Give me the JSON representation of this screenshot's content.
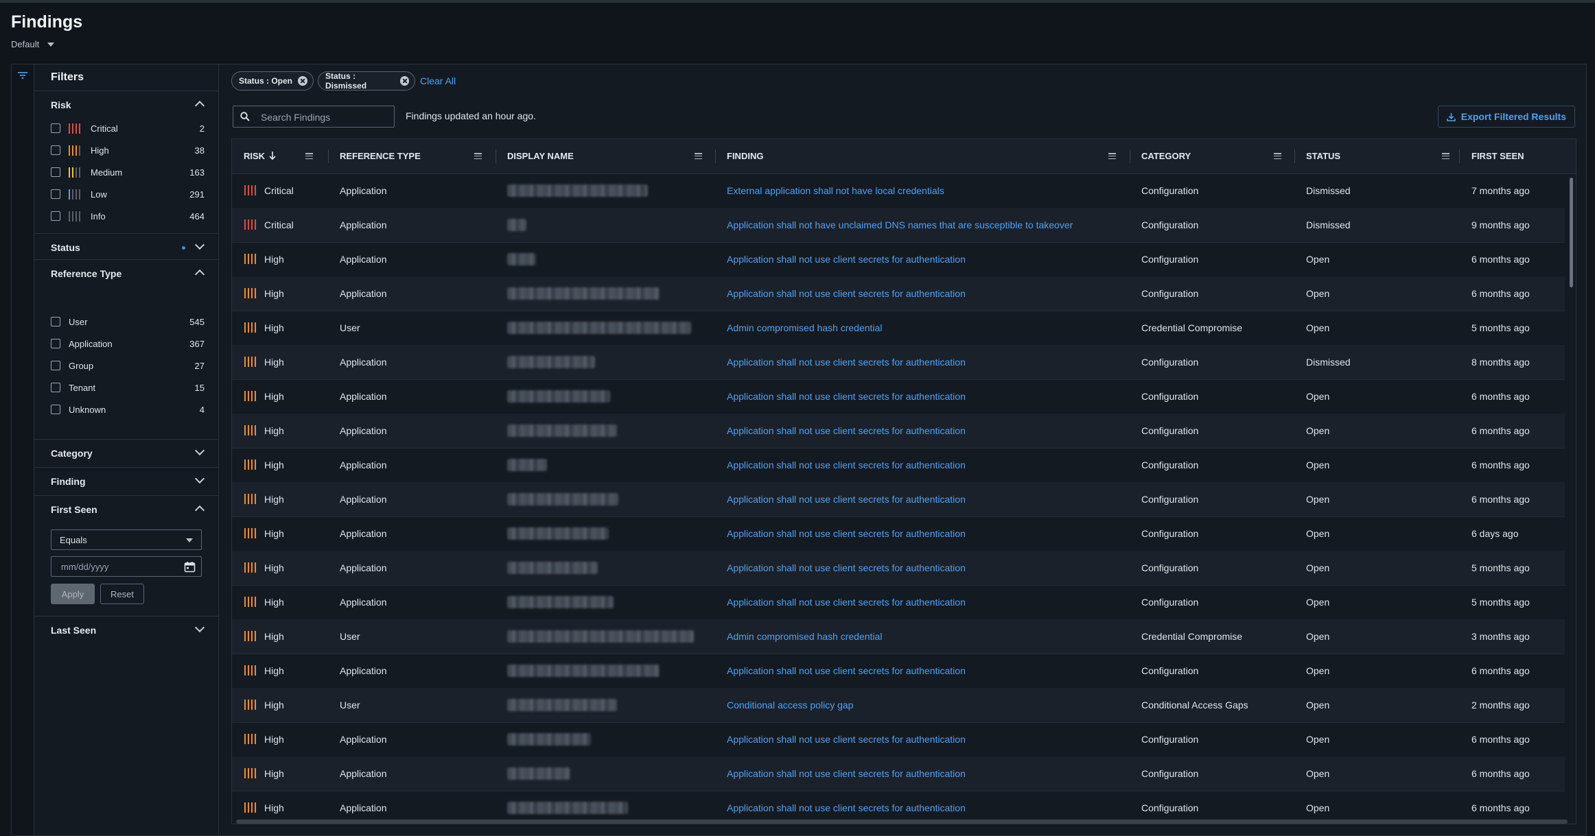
{
  "page": {
    "title": "Findings",
    "view": "Default"
  },
  "colors": {
    "critical": "#e04b3d",
    "high": "#f08a2c",
    "medium": "#e9c23c",
    "low": "#5aa0d8",
    "info": "#8a939e",
    "inactive": "#59606a",
    "link": "#4ea1f3"
  },
  "filters": {
    "title": "Filters",
    "risk": {
      "label": "Risk",
      "items": [
        {
          "label": "Critical",
          "count": "2",
          "level": 4,
          "color": "#e04b3d"
        },
        {
          "label": "High",
          "count": "38",
          "level": 3,
          "color": "#f08a2c"
        },
        {
          "label": "Medium",
          "count": "163",
          "level": 2,
          "color": "#e9c23c"
        },
        {
          "label": "Low",
          "count": "291",
          "level": 1,
          "color": "#5aa0d8"
        },
        {
          "label": "Info",
          "count": "464",
          "level": 0,
          "color": "#8a939e"
        }
      ]
    },
    "status": {
      "label": "Status"
    },
    "reference_type": {
      "label": "Reference Type",
      "items": [
        {
          "label": "User",
          "count": "545"
        },
        {
          "label": "Application",
          "count": "367"
        },
        {
          "label": "Group",
          "count": "27"
        },
        {
          "label": "Tenant",
          "count": "15"
        },
        {
          "label": "Unknown",
          "count": "4"
        }
      ]
    },
    "category": {
      "label": "Category"
    },
    "finding": {
      "label": "Finding"
    },
    "first_seen": {
      "label": "First Seen",
      "operator": "Equals",
      "date_placeholder": "mm/dd/yyyy",
      "apply_label": "Apply",
      "reset_label": "Reset"
    },
    "last_seen": {
      "label": "Last Seen"
    }
  },
  "chips": [
    {
      "label": "Status : Open"
    },
    {
      "label": "Status : Dismissed"
    }
  ],
  "clear_all": "Clear All",
  "search": {
    "placeholder": "Search Findings"
  },
  "updated_text": "Findings updated an hour ago.",
  "export_label": "Export Filtered Results",
  "table": {
    "columns": [
      "RISK",
      "REFERENCE TYPE",
      "DISPLAY NAME",
      "FINDING",
      "CATEGORY",
      "STATUS",
      "FIRST SEEN"
    ],
    "rows": [
      {
        "risk": "Critical",
        "ref": "Application",
        "finding": "External application shall not have local credentials",
        "category": "Configuration",
        "status": "Dismissed",
        "first_seen": "7 months ago"
      },
      {
        "risk": "Critical",
        "ref": "Application",
        "finding": "Application shall not have unclaimed DNS names that are susceptible to takeover",
        "category": "Configuration",
        "status": "Dismissed",
        "first_seen": "9 months ago"
      },
      {
        "risk": "High",
        "ref": "Application",
        "finding": "Application shall not use client secrets for authentication",
        "category": "Configuration",
        "status": "Open",
        "first_seen": "6 months ago"
      },
      {
        "risk": "High",
        "ref": "Application",
        "finding": "Application shall not use client secrets for authentication",
        "category": "Configuration",
        "status": "Open",
        "first_seen": "6 months ago"
      },
      {
        "risk": "High",
        "ref": "User",
        "finding": "Admin compromised hash credential",
        "category": "Credential Compromise",
        "status": "Open",
        "first_seen": "5 months ago"
      },
      {
        "risk": "High",
        "ref": "Application",
        "finding": "Application shall not use client secrets for authentication",
        "category": "Configuration",
        "status": "Dismissed",
        "first_seen": "8 months ago"
      },
      {
        "risk": "High",
        "ref": "Application",
        "finding": "Application shall not use client secrets for authentication",
        "category": "Configuration",
        "status": "Open",
        "first_seen": "6 months ago"
      },
      {
        "risk": "High",
        "ref": "Application",
        "finding": "Application shall not use client secrets for authentication",
        "category": "Configuration",
        "status": "Open",
        "first_seen": "6 months ago"
      },
      {
        "risk": "High",
        "ref": "Application",
        "finding": "Application shall not use client secrets for authentication",
        "category": "Configuration",
        "status": "Open",
        "first_seen": "6 months ago"
      },
      {
        "risk": "High",
        "ref": "Application",
        "finding": "Application shall not use client secrets for authentication",
        "category": "Configuration",
        "status": "Open",
        "first_seen": "6 months ago"
      },
      {
        "risk": "High",
        "ref": "Application",
        "finding": "Application shall not use client secrets for authentication",
        "category": "Configuration",
        "status": "Open",
        "first_seen": "6 days ago"
      },
      {
        "risk": "High",
        "ref": "Application",
        "finding": "Application shall not use client secrets for authentication",
        "category": "Configuration",
        "status": "Open",
        "first_seen": "5 months ago"
      },
      {
        "risk": "High",
        "ref": "Application",
        "finding": "Application shall not use client secrets for authentication",
        "category": "Configuration",
        "status": "Open",
        "first_seen": "5 months ago"
      },
      {
        "risk": "High",
        "ref": "User",
        "finding": "Admin compromised hash credential",
        "category": "Credential Compromise",
        "status": "Open",
        "first_seen": "3 months ago"
      },
      {
        "risk": "High",
        "ref": "Application",
        "finding": "Application shall not use client secrets for authentication",
        "category": "Configuration",
        "status": "Open",
        "first_seen": "6 months ago"
      },
      {
        "risk": "High",
        "ref": "User",
        "finding": "Conditional access policy gap",
        "category": "Conditional Access Gaps",
        "status": "Open",
        "first_seen": "2 months ago"
      },
      {
        "risk": "High",
        "ref": "Application",
        "finding": "Application shall not use client secrets for authentication",
        "category": "Configuration",
        "status": "Open",
        "first_seen": "6 months ago"
      },
      {
        "risk": "High",
        "ref": "Application",
        "finding": "Application shall not use client secrets for authentication",
        "category": "Configuration",
        "status": "Open",
        "first_seen": "6 months ago"
      },
      {
        "risk": "High",
        "ref": "Application",
        "finding": "Application shall not use client secrets for authentication",
        "category": "Configuration",
        "status": "Open",
        "first_seen": "6 months ago"
      }
    ]
  }
}
